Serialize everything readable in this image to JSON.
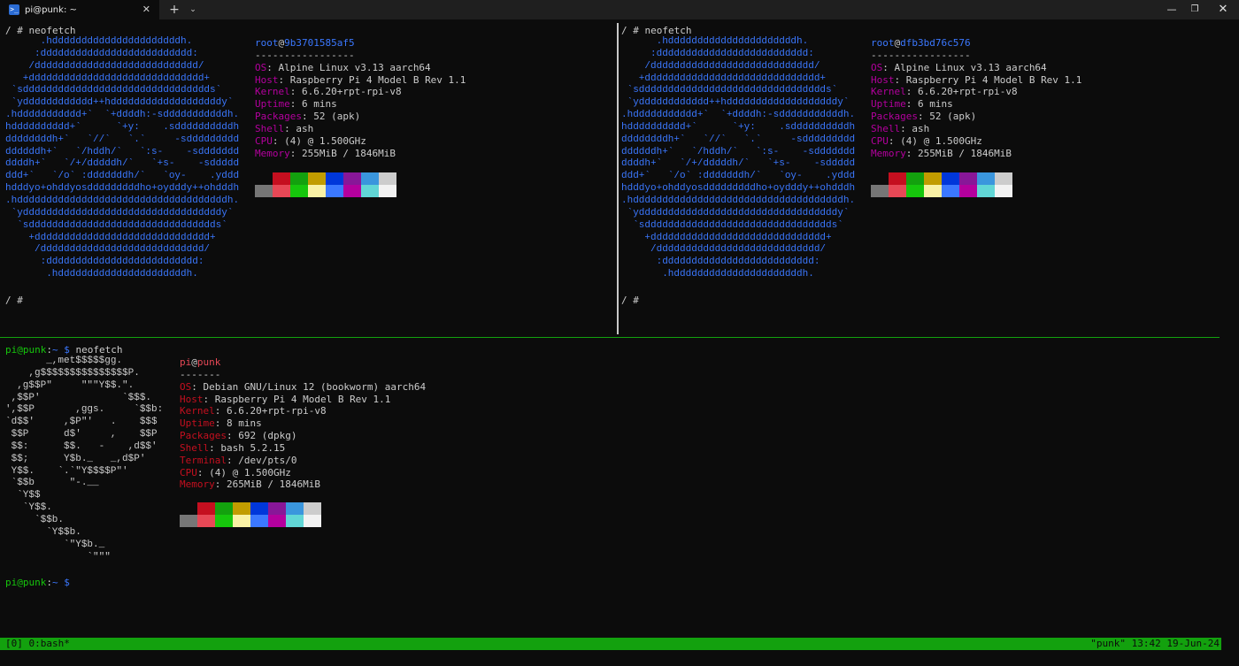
{
  "window": {
    "tab_title": "pi@punk: ~",
    "tab_icon": ">_",
    "tab_close": "✕",
    "new_tab": "+",
    "dropdown": "⌄",
    "minimize": "—",
    "maximize": "❐",
    "close": "✕"
  },
  "colors": {
    "background": "#0c0c0c",
    "green": "#13a10e",
    "blue": "#3b78ff",
    "red": "#e74856",
    "purple": "#b4009e",
    "dark_red": "#c50f1f"
  },
  "palette": {
    "row1": [
      "#0c0c0c",
      "#c50f1f",
      "#13a10e",
      "#c19c00",
      "#0037da",
      "#881798",
      "#3a96dd",
      "#cccccc"
    ],
    "row2": [
      "#767676",
      "#e74856",
      "#16c60c",
      "#f9f1a5",
      "#3b78ff",
      "#b4009e",
      "#61d6d6",
      "#f2f2f2"
    ]
  },
  "alpine_logo": "      .hddddddddddddddddddddddh.\n     :dddddddddddddddddddddddddd:\n    /dddddddddddddddddddddddddddd/\n   +dddddddddddddddddddddddddddddd+\n `sdddddddddddddddddddddddddddddddds`\n `ydddddddddddd++hdddddddddddddddddddy`\n.hddddddddddd+`  `+ddddh:-sdddddddddddh.\nhdddddddddd+`      `+y:    .sddddddddddh\nddddddddh+`   `//`   `.`     -sddddddddd\nddddddh+`   `/hddh/`   `:s-    -sddddddd\nddddh+`   `/+/dddddh/`   `+s-    -sddddd\nddd+`   `/o` :dddddddh/`   `oy-    .yddd\nhdddyo+ohddyosdddddddddho+oydddy++ohdddh\n.hddddddddddddddddddddddddddddddddddddh.\n `yddddddddddddddddddddddddddddddddddy`\n  `sdddddddddddddddddddddddddddddddds`\n    +dddddddddddddddddddddddddddddd+\n     /dddddddddddddddddddddddddddd/\n      :dddddddddddddddddddddddddd:\n       .hddddddddddddddddddddddh.",
  "pane_left": {
    "command_prompt": "/ # ",
    "command": "neofetch",
    "user": "root",
    "at": "@",
    "host": "9b3701585af5",
    "separator": "-----------------",
    "fields": [
      {
        "key": "OS",
        "value": ": Alpine Linux v3.13 aarch64"
      },
      {
        "key": "Host",
        "value": ": Raspberry Pi 4 Model B Rev 1.1"
      },
      {
        "key": "Kernel",
        "value": ": 6.6.20+rpt-rpi-v8"
      },
      {
        "key": "Uptime",
        "value": ": 6 mins"
      },
      {
        "key": "Packages",
        "value": ": 52 (apk)"
      },
      {
        "key": "Shell",
        "value": ": ash"
      },
      {
        "key": "CPU",
        "value": ": (4) @ 1.500GHz"
      },
      {
        "key": "Memory",
        "value": ": 255MiB / 1846MiB"
      }
    ],
    "final_prompt": "/ #"
  },
  "pane_right": {
    "command_prompt": "/ # ",
    "command": "neofetch",
    "user": "root",
    "at": "@",
    "host": "dfb3bd76c576",
    "separator": "-----------------",
    "fields": [
      {
        "key": "OS",
        "value": ": Alpine Linux v3.13 aarch64"
      },
      {
        "key": "Host",
        "value": ": Raspberry Pi 4 Model B Rev 1.1"
      },
      {
        "key": "Kernel",
        "value": ": 6.6.20+rpt-rpi-v8"
      },
      {
        "key": "Uptime",
        "value": ": 6 mins"
      },
      {
        "key": "Packages",
        "value": ": 52 (apk)"
      },
      {
        "key": "Shell",
        "value": ": ash"
      },
      {
        "key": "CPU",
        "value": ": (4) @ 1.500GHz"
      },
      {
        "key": "Memory",
        "value": ": 255MiB / 1846MiB"
      }
    ],
    "final_prompt": "/ #"
  },
  "pane_bottom": {
    "prompt_user": "pi@punk",
    "prompt_colon": ":",
    "prompt_path": "~ $ ",
    "command": "neofetch",
    "debian_logo": "       _,met$$$$$gg.\n    ,g$$$$$$$$$$$$$$$P.\n  ,g$$P\"     \"\"\"Y$$.\".\n ,$$P'              `$$$.\n',$$P       ,ggs.     `$$b:\n`d$$'     ,$P\"'   .    $$$\n $$P      d$'     ,    $$P\n $$:      $$.   -    ,d$$'\n $$;      Y$b._   _,d$P'\n Y$$.    `.`\"Y$$$$P\"'\n `$$b      \"-.__\n  `Y$$\n   `Y$$.\n     `$$b.\n       `Y$$b.\n          `\"Y$b._\n              `\"\"\"",
    "user": "pi",
    "at": "@",
    "host": "punk",
    "separator": "-------",
    "fields": [
      {
        "key": "OS",
        "value": ": Debian GNU/Linux 12 (bookworm) aarch64"
      },
      {
        "key": "Host",
        "value": ": Raspberry Pi 4 Model B Rev 1.1"
      },
      {
        "key": "Kernel",
        "value": ": 6.6.20+rpt-rpi-v8"
      },
      {
        "key": "Uptime",
        "value": ": 8 mins"
      },
      {
        "key": "Packages",
        "value": ": 692 (dpkg)"
      },
      {
        "key": "Shell",
        "value": ": bash 5.2.15"
      },
      {
        "key": "Terminal",
        "value": ": /dev/pts/0"
      },
      {
        "key": "CPU",
        "value": ": (4) @ 1.500GHz"
      },
      {
        "key": "Memory",
        "value": ": 265MiB / 1846MiB"
      }
    ],
    "final_prompt_user": "pi@punk",
    "final_prompt_colon": ":",
    "final_prompt_path": "~ $"
  },
  "status_bar": {
    "left": "[0] 0:bash*",
    "right": "\"punk\" 13:42 19-Jun-24"
  }
}
